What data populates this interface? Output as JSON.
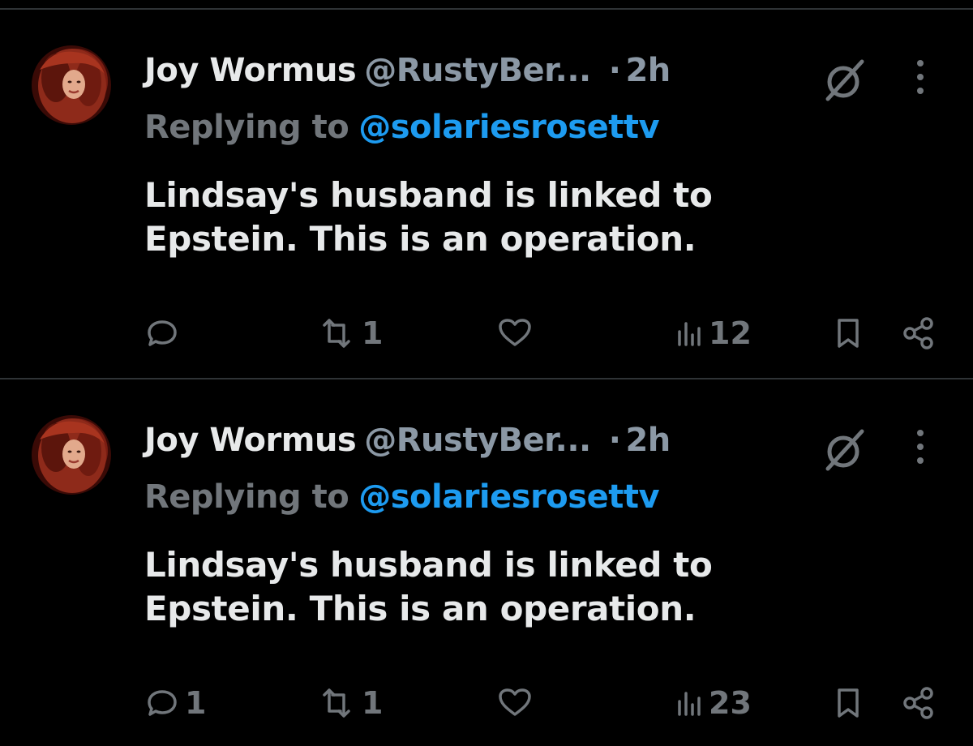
{
  "colors": {
    "background": "#000000",
    "divider": "#2f3336",
    "name": "#e7e9ea",
    "muted": "#71767b",
    "link": "#1d9bf0"
  },
  "tweets": [
    {
      "name": "Joy Wormus",
      "handle": "@RustyBer...",
      "dot": "·",
      "time": "2h",
      "reply_prefix": "Replying to",
      "reply_handle": "@solariesrosettv",
      "text": "Lindsay's husband is linked to Epstein. This is an operation.",
      "icons": [
        "grok-icon",
        "more-icon"
      ],
      "actions": {
        "replies": "",
        "retweets": "1",
        "likes": "",
        "views": "12"
      }
    },
    {
      "name": "Joy Wormus",
      "handle": "@RustyBer...",
      "dot": "·",
      "time": "2h",
      "reply_prefix": "Replying to",
      "reply_handle": "@solariesrosettv",
      "text": "Lindsay's husband is linked to Epstein. This is an operation.",
      "icons": [
        "grok-icon",
        "more-icon"
      ],
      "actions": {
        "replies": "1",
        "retweets": "1",
        "likes": "",
        "views": "23"
      }
    }
  ]
}
